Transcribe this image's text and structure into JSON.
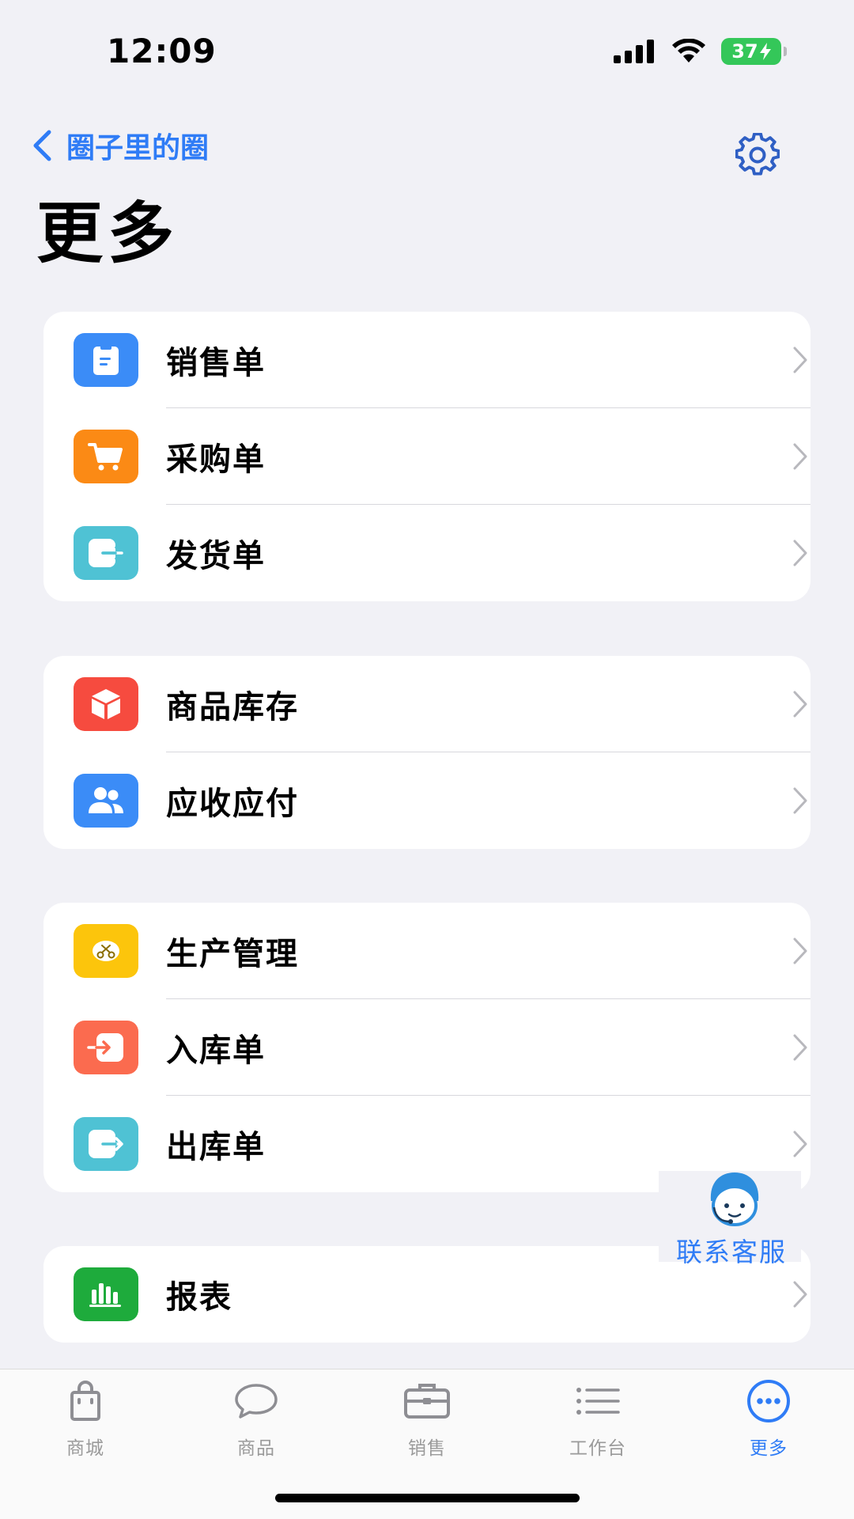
{
  "status": {
    "time": "12:09",
    "battery": "37"
  },
  "nav": {
    "back_label": "圈子里的圈"
  },
  "page": {
    "title": "更多"
  },
  "groups": [
    {
      "items": [
        {
          "label": "销售单",
          "icon": "sales-order-icon",
          "color": "#3b8cf7"
        },
        {
          "label": "采购单",
          "icon": "shopping-cart-icon",
          "color": "#fb8a15"
        },
        {
          "label": "发货单",
          "icon": "exit-arrow-icon",
          "color": "#4fc2d4"
        }
      ]
    },
    {
      "items": [
        {
          "label": "商品库存",
          "icon": "box-icon",
          "color": "#f64b3f"
        },
        {
          "label": "应收应付",
          "icon": "users-icon",
          "color": "#3b8cf7"
        }
      ]
    },
    {
      "items": [
        {
          "label": "生产管理",
          "icon": "scissors-icon",
          "color": "#fcc50c"
        },
        {
          "label": "入库单",
          "icon": "enter-arrow-icon",
          "color": "#fb6b4f"
        },
        {
          "label": "出库单",
          "icon": "exit-arrow-icon",
          "color": "#4fc2d4"
        }
      ]
    },
    {
      "items": [
        {
          "label": "报表",
          "icon": "bar-chart-icon",
          "color": "#1eab3c"
        }
      ]
    }
  ],
  "customer_service": {
    "label": "联系客服"
  },
  "tabs": [
    {
      "label": "商城",
      "icon": "shopping-bag-icon",
      "active": false
    },
    {
      "label": "商品",
      "icon": "chat-bubble-icon",
      "active": false
    },
    {
      "label": "销售",
      "icon": "briefcase-icon",
      "active": false
    },
    {
      "label": "工作台",
      "icon": "list-icon",
      "active": false
    },
    {
      "label": "更多",
      "icon": "more-dots-icon",
      "active": true
    }
  ],
  "colors": {
    "accent": "#2f7cf6",
    "background": "#f1f1f6"
  }
}
